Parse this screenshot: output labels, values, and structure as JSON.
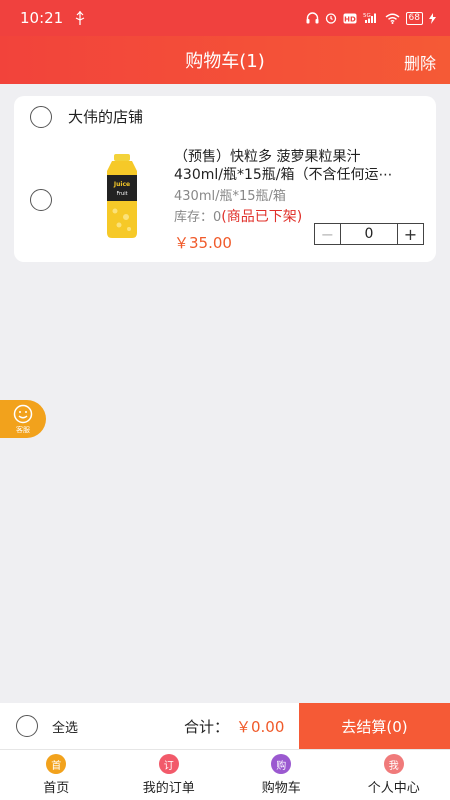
{
  "status": {
    "time": "10:21",
    "usb_icon": "usb-icon",
    "network": "5G",
    "battery": "68"
  },
  "header": {
    "title": "购物车(1)",
    "delete_label": "删除"
  },
  "store": {
    "name": "大伟的店铺"
  },
  "product": {
    "title_line1": "（预售）快粒多 菠萝果粒果汁",
    "title_line2": "430ml/瓶*15瓶/箱（不含任何运⋯",
    "spec": "430ml/瓶*15瓶/箱",
    "stock_prefix": "库存：0",
    "stock_warning": "(商品已下架)",
    "price": "￥35.00",
    "quantity": "0",
    "minus_label": "−",
    "plus_label": "+"
  },
  "service": {
    "label": "客服"
  },
  "checkout": {
    "select_all_label": "全选",
    "total_label": "合计：",
    "total_value": "￥0.00",
    "button_label": "去结算(0)"
  },
  "tabs": [
    {
      "label": "首页",
      "icon_text": "首",
      "icon_color": "#f2a21c"
    },
    {
      "label": "我的订单",
      "icon_text": "订",
      "icon_color": "#f25a6a"
    },
    {
      "label": "购物车",
      "icon_text": "购",
      "icon_color": "#9b59d0"
    },
    {
      "label": "个人中心",
      "icon_text": "我",
      "icon_color": "#f07a7a"
    }
  ],
  "colors": {
    "header": "#f2433b",
    "accent": "#f55a36",
    "price": "#f05a2a",
    "warning": "#e0302a"
  }
}
